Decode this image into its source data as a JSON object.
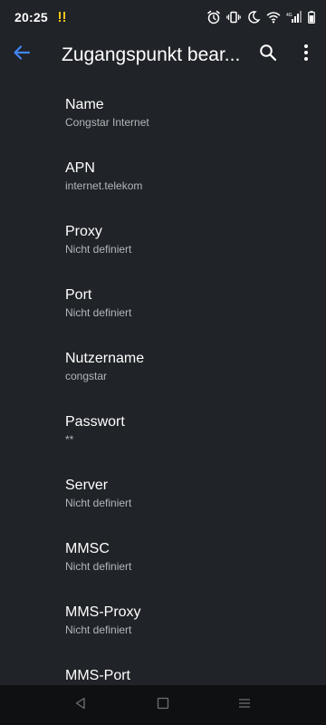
{
  "status_bar": {
    "time": "20:25",
    "icons": [
      "notification-icon",
      "alarm-icon",
      "vibrate-icon",
      "do-not-disturb-moon-icon",
      "wifi-icon",
      "signal-icon",
      "battery-icon"
    ]
  },
  "app_bar": {
    "title": "Zugangspunkt bear...",
    "icons": [
      "back-arrow-icon",
      "search-icon",
      "more-vert-icon"
    ]
  },
  "colors": {
    "background": "#202327",
    "accent": "#4285f4",
    "secondary_text": "#b3b6ba",
    "nav_bar": "#0f1012"
  },
  "settings": [
    {
      "title": "Name",
      "summary": "Congstar Internet"
    },
    {
      "title": "APN",
      "summary": "internet.telekom"
    },
    {
      "title": "Proxy",
      "summary": "Nicht definiert"
    },
    {
      "title": "Port",
      "summary": "Nicht definiert"
    },
    {
      "title": "Nutzername",
      "summary": "congstar"
    },
    {
      "title": "Passwort",
      "summary": "**"
    },
    {
      "title": "Server",
      "summary": "Nicht definiert"
    },
    {
      "title": "MMSC",
      "summary": "Nicht definiert"
    },
    {
      "title": "MMS-Proxy",
      "summary": "Nicht definiert"
    },
    {
      "title": "MMS-Port",
      "summary": ""
    }
  ],
  "nav_bar": {
    "icons": [
      "back-triangle-icon",
      "home-square-icon",
      "recents-menu-icon"
    ]
  }
}
